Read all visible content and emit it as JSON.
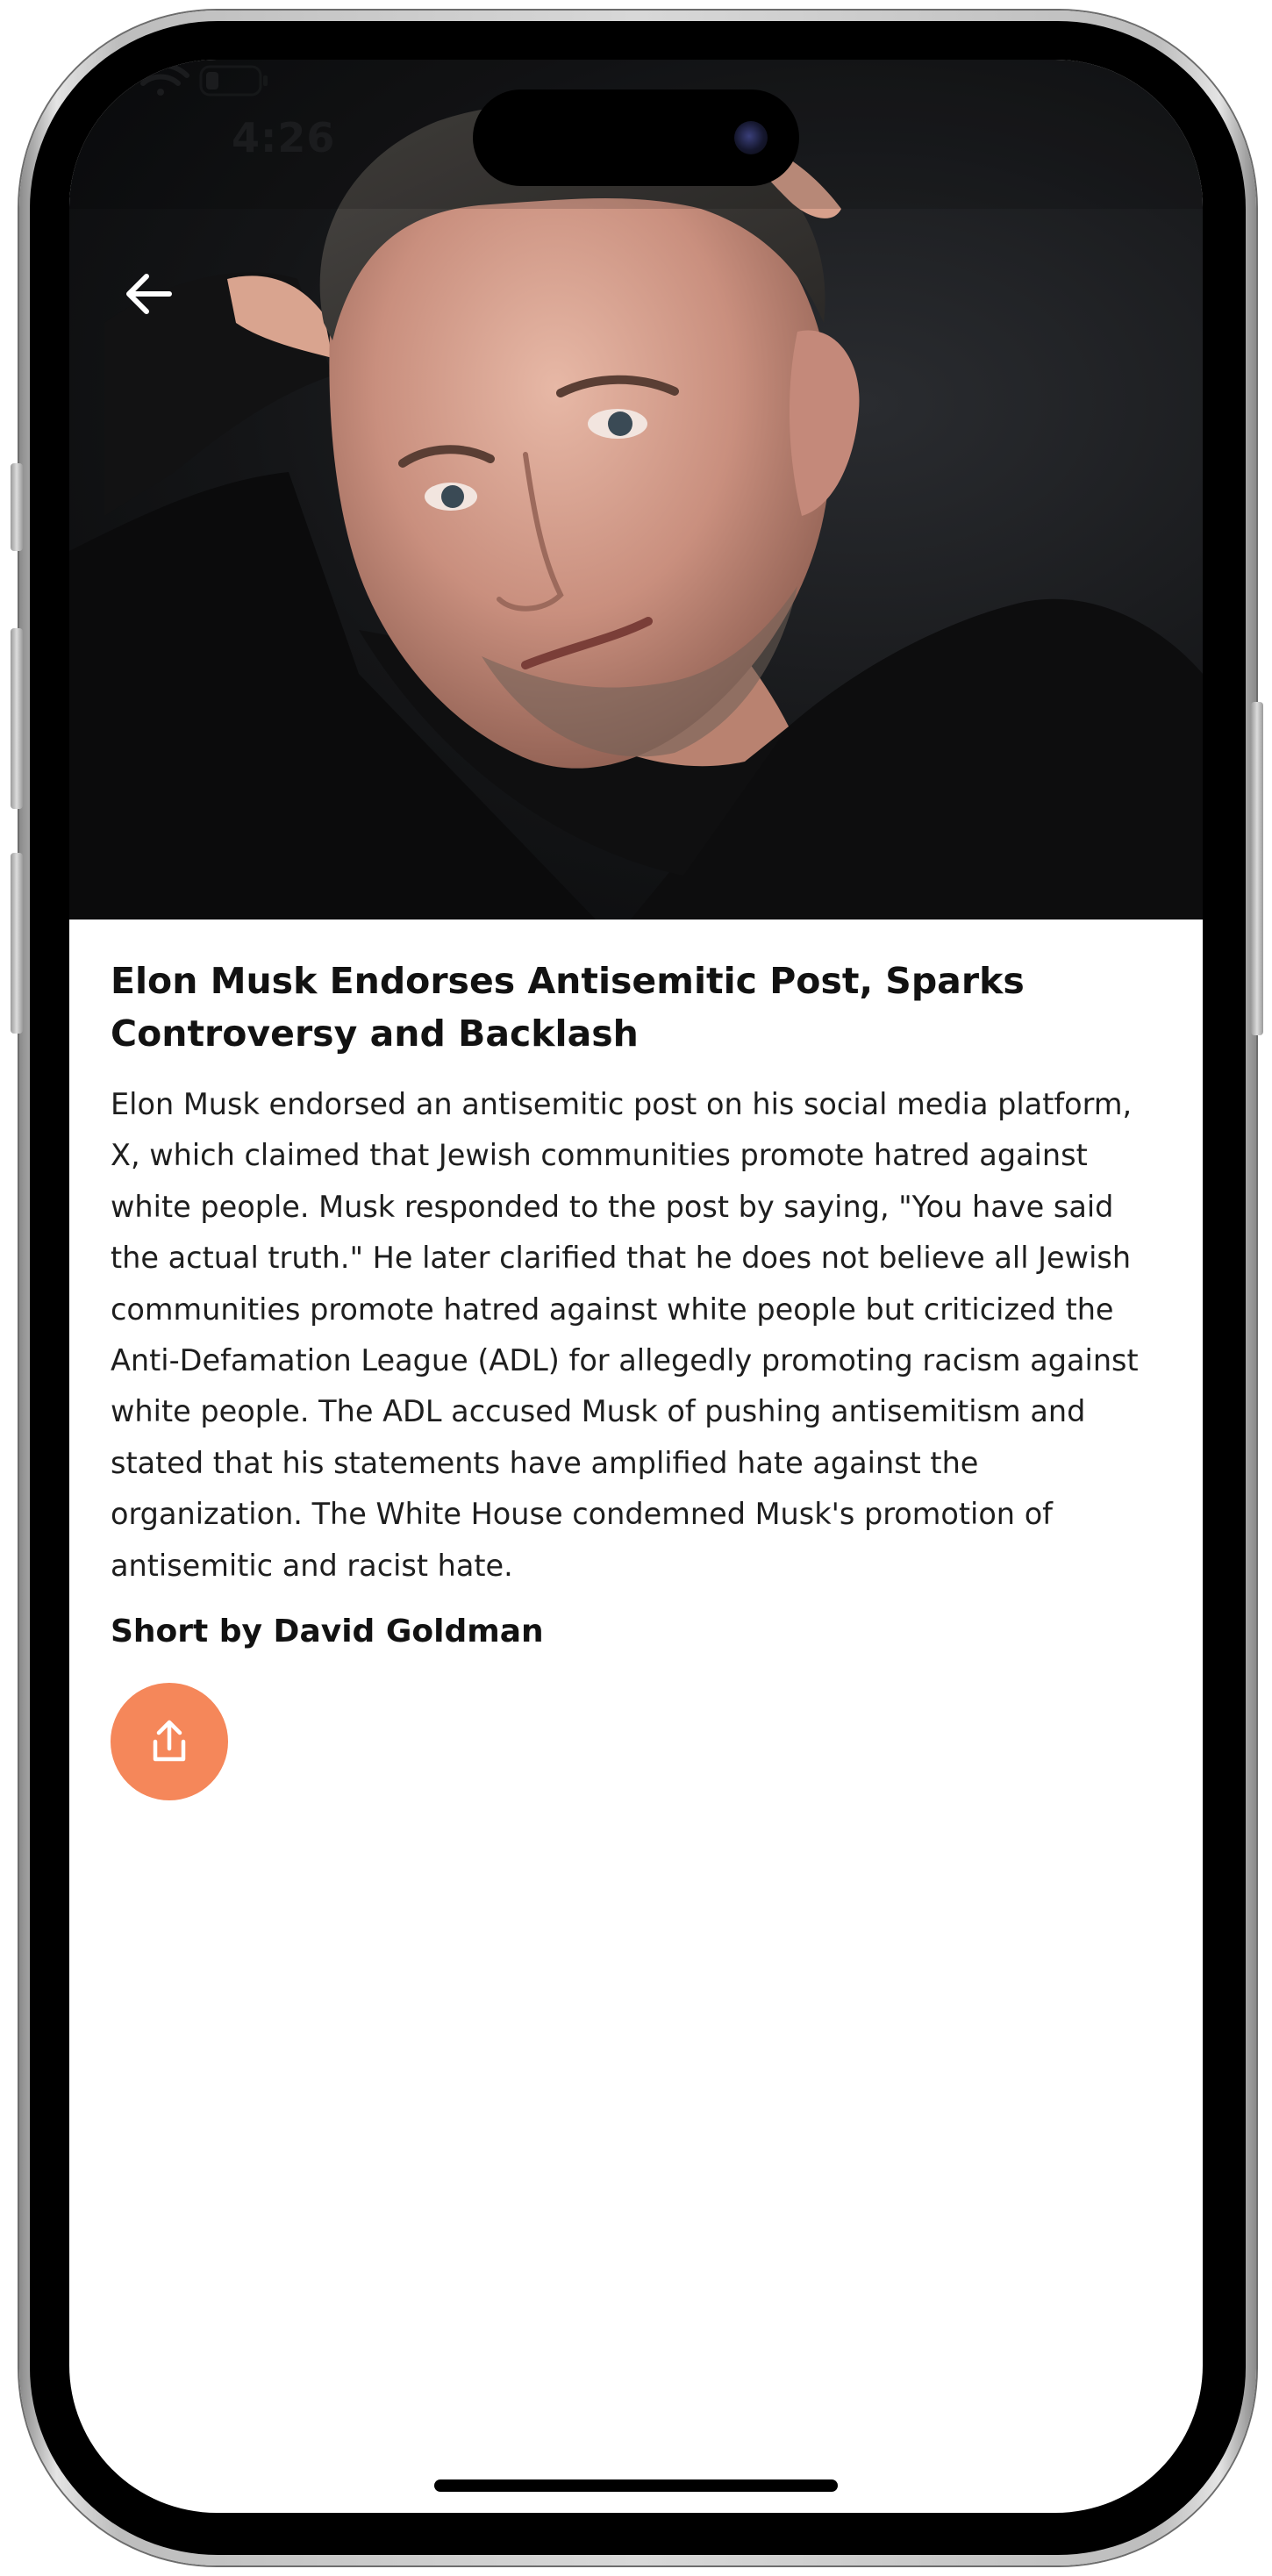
{
  "status_bar": {
    "time": "4:26"
  },
  "nav": {
    "back_icon": "arrow-left-icon"
  },
  "article": {
    "title": "Elon Musk Endorses Antisemitic Post, Sparks Controversy and Backlash",
    "body": "Elon Musk endorsed an antisemitic post on his social media platform, X, which claimed that Jewish communities promote hatred against white people. Musk responded to the post by saying, \"You have said the actual truth.\" He later clarified that he does not believe all Jewish communities promote hatred against white people but criticized the Anti-Defamation League (ADL) for allegedly promoting racism against white people. The ADL accused Musk of pushing antisemitism and stated that his statements have amplified hate against the organization. The White House condemned Musk's promotion of antisemitic and racist hate.",
    "byline": "Short by David Goldman",
    "share_icon": "share-icon"
  },
  "colors": {
    "share_button": "#f5875a",
    "text": "#1e1e1e",
    "background": "#ffffff"
  }
}
